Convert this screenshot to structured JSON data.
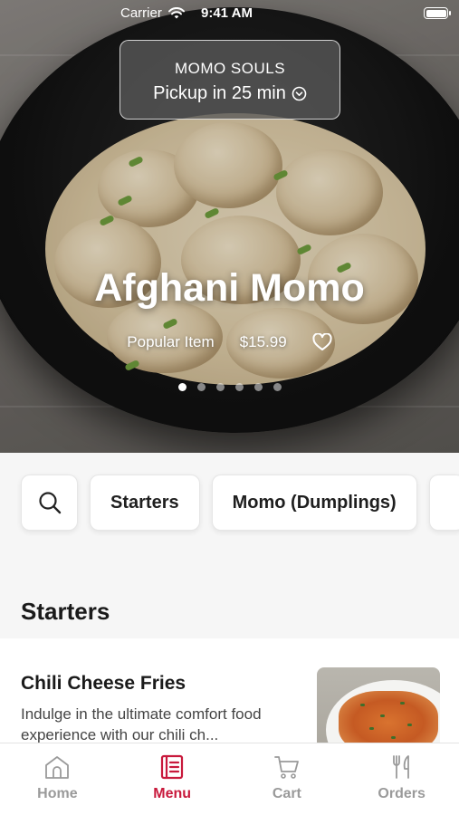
{
  "status_bar": {
    "carrier": "Carrier",
    "time": "9:41 AM"
  },
  "store": {
    "name": "MOMO SOULS",
    "pickup": "Pickup in 25 min"
  },
  "hero": {
    "title": "Afghani Momo",
    "badge": "Popular Item",
    "price": "$15.99",
    "slides_total": 6,
    "active_slide": 1
  },
  "categories": [
    {
      "label": "Starters"
    },
    {
      "label": "Momo (Dumplings)"
    }
  ],
  "section": {
    "title": "Starters"
  },
  "items": [
    {
      "name": "Chili Cheese Fries",
      "description": "Indulge in the ultimate comfort food experience with our chili ch..."
    }
  ],
  "tabs": [
    {
      "label": "Home",
      "icon": "home-icon",
      "active": false
    },
    {
      "label": "Menu",
      "icon": "menu-book-icon",
      "active": true
    },
    {
      "label": "Cart",
      "icon": "cart-icon",
      "active": false
    },
    {
      "label": "Orders",
      "icon": "fork-knife-icon",
      "active": false
    }
  ],
  "colors": {
    "accent": "#c8193c",
    "inactive": "#9a9a9a"
  }
}
